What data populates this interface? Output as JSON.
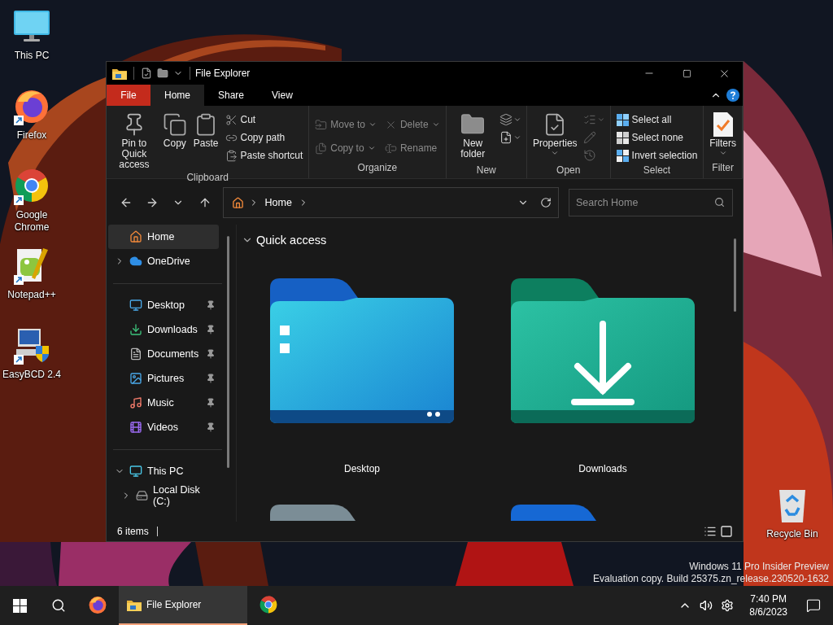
{
  "desktop_icons": [
    {
      "label": "This PC",
      "shortcut": false
    },
    {
      "label": "Firefox",
      "shortcut": true
    },
    {
      "label": "Google Chrome",
      "shortcut": true
    },
    {
      "label": "Notepad++",
      "shortcut": true
    },
    {
      "label": "EasyBCD 2.4",
      "shortcut": true
    }
  ],
  "recycle_bin": {
    "label": "Recycle Bin"
  },
  "window": {
    "title": "File Explorer"
  },
  "ribbon_tabs": [
    {
      "label": "File",
      "kind": "file",
      "selected": false
    },
    {
      "label": "Home",
      "kind": "tab",
      "selected": true
    },
    {
      "label": "Share",
      "kind": "tab",
      "selected": false
    },
    {
      "label": "View",
      "kind": "tab",
      "selected": false
    }
  ],
  "ribbon_groups": [
    {
      "label": "Clipboard",
      "commands": [
        {
          "label": "Pin to Quick access",
          "kind": "large",
          "disabled": false,
          "dropdown": false
        },
        {
          "label": "Copy",
          "kind": "large",
          "disabled": false,
          "dropdown": false
        },
        {
          "label": "Paste",
          "kind": "large",
          "disabled": false,
          "dropdown": false
        },
        {
          "label": "Cut",
          "kind": "small",
          "disabled": false,
          "dropdown": false
        },
        {
          "label": "Copy path",
          "kind": "small",
          "disabled": false,
          "dropdown": false
        },
        {
          "label": "Paste shortcut",
          "kind": "small",
          "disabled": false,
          "dropdown": false
        }
      ]
    },
    {
      "label": "Organize",
      "commands": [
        {
          "label": "Move to",
          "kind": "small",
          "disabled": true,
          "dropdown": true
        },
        {
          "label": "Copy to",
          "kind": "small",
          "disabled": true,
          "dropdown": true
        },
        {
          "label": "Delete",
          "kind": "small",
          "disabled": true,
          "dropdown": true
        },
        {
          "label": "Rename",
          "kind": "small",
          "disabled": true,
          "dropdown": false
        }
      ]
    },
    {
      "label": "New",
      "commands": [
        {
          "label": "New folder",
          "kind": "large",
          "disabled": false,
          "dropdown": false
        },
        {
          "kind": "icon",
          "disabled": false,
          "dropdown": true
        },
        {
          "kind": "icon",
          "disabled": false,
          "dropdown": true
        }
      ]
    },
    {
      "label": "Open",
      "commands": [
        {
          "label": "Properties",
          "kind": "large",
          "disabled": false,
          "dropdown": true
        },
        {
          "kind": "icon",
          "disabled": true,
          "dropdown": true
        },
        {
          "kind": "icon",
          "disabled": true,
          "dropdown": false
        },
        {
          "kind": "icon",
          "disabled": true,
          "dropdown": false
        }
      ]
    },
    {
      "label": "Select",
      "commands": [
        {
          "label": "Select all",
          "kind": "small",
          "disabled": false,
          "dropdown": false
        },
        {
          "label": "Select none",
          "kind": "small",
          "disabled": false,
          "dropdown": false
        },
        {
          "label": "Invert selection",
          "kind": "small",
          "disabled": false,
          "dropdown": false
        }
      ]
    },
    {
      "label": "Filter",
      "commands": [
        {
          "label": "Filters",
          "kind": "large",
          "disabled": false,
          "dropdown": true
        }
      ]
    }
  ],
  "address_bar": {
    "breadcrumb": [
      "Home"
    ]
  },
  "search": {
    "placeholder": "Search Home"
  },
  "nav_pane": {
    "sections": [
      {
        "items": [
          {
            "label": "Home",
            "selected": true,
            "pinned": false
          },
          {
            "label": "OneDrive",
            "selected": false,
            "pinned": false,
            "expanded": false
          }
        ]
      },
      {
        "items": [
          {
            "label": "Desktop",
            "selected": false,
            "pinned": true
          },
          {
            "label": "Downloads",
            "selected": false,
            "pinned": true
          },
          {
            "label": "Documents",
            "selected": false,
            "pinned": true
          },
          {
            "label": "Pictures",
            "selected": false,
            "pinned": true
          },
          {
            "label": "Music",
            "selected": false,
            "pinned": true
          },
          {
            "label": "Videos",
            "selected": false,
            "pinned": true
          }
        ]
      },
      {
        "items": [
          {
            "label": "This PC",
            "selected": false,
            "pinned": false,
            "expanded": true,
            "children": [
              {
                "label": "Local Disk (C:)",
                "selected": false,
                "pinned": false,
                "expanded": false
              }
            ]
          }
        ]
      }
    ]
  },
  "content": {
    "section": {
      "label": "Quick access",
      "expanded": true
    },
    "items": [
      {
        "label": "Desktop",
        "kind": "full"
      },
      {
        "label": "Downloads",
        "kind": "full"
      },
      {
        "kind": "partial"
      },
      {
        "kind": "partial"
      }
    ]
  },
  "status_bar": {
    "item_count": "6 items"
  },
  "taskbar": {
    "apps": [
      {
        "selected": false
      },
      {
        "label": "File Explorer",
        "selected": true
      },
      {
        "selected": false
      }
    ],
    "clock": {
      "time": "7:40 PM",
      "date": "8/6/2023"
    }
  },
  "build_info": {
    "lines": [
      "Windows 11 Pro Insider Preview",
      "Evaluation copy. Build 25375.zn_release.230520-1632"
    ]
  }
}
